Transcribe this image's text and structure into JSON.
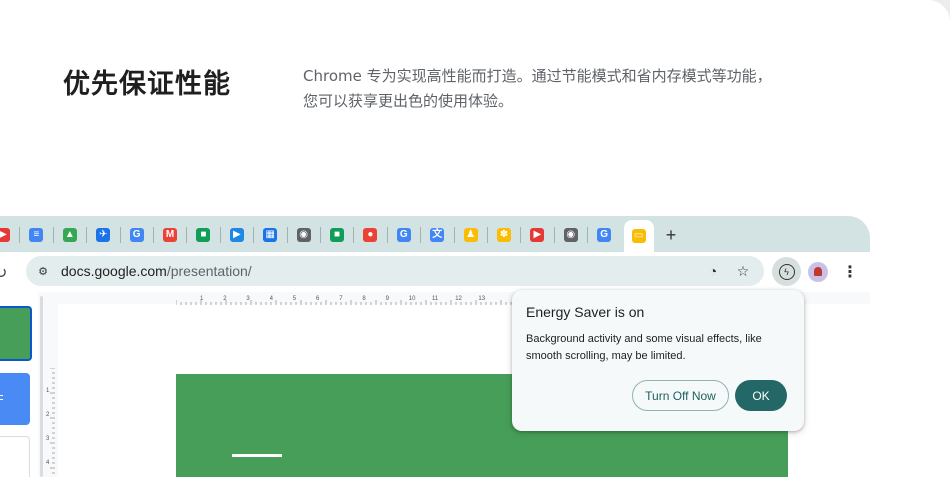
{
  "hero": {
    "title": "优先保证性能",
    "description": "Chrome 专为实现高性能而打造。通过节能模式和省内存模式等功能，您可以获享更出色的使用体验。"
  },
  "tabs": [
    {
      "icon": "youtube-icon",
      "color": "#e53935",
      "glyph": "▶"
    },
    {
      "icon": "google-docs-icon",
      "color": "#4285f4",
      "glyph": "≡"
    },
    {
      "icon": "google-drive-icon",
      "color": "#34a853",
      "glyph": "▲"
    },
    {
      "icon": "flights-icon",
      "color": "#1a73e8",
      "glyph": "✈"
    },
    {
      "icon": "google-icon",
      "color": "#4285f4",
      "glyph": "G"
    },
    {
      "icon": "gmail-icon",
      "color": "#ea4335",
      "glyph": "M"
    },
    {
      "icon": "google-meet-icon",
      "color": "#0f9d58",
      "glyph": "■"
    },
    {
      "icon": "google-play-icon",
      "color": "#1e88e5",
      "glyph": "▶"
    },
    {
      "icon": "google-calendar-icon",
      "color": "#1a73e8",
      "glyph": "▦"
    },
    {
      "icon": "chrome-icon",
      "color": "#5f6368",
      "glyph": "◉"
    },
    {
      "icon": "google-chat-icon",
      "color": "#0f9d58",
      "glyph": "■"
    },
    {
      "icon": "google-maps-icon",
      "color": "#ea4335",
      "glyph": "●"
    },
    {
      "icon": "google-icon",
      "color": "#4285f4",
      "glyph": "G"
    },
    {
      "icon": "google-translate-icon",
      "color": "#4285f4",
      "glyph": "文"
    },
    {
      "icon": "chrome-dino-icon",
      "color": "#fbbc04",
      "glyph": "♟"
    },
    {
      "icon": "google-photos-icon",
      "color": "#fbbc04",
      "glyph": "✽"
    },
    {
      "icon": "youtube-music-icon",
      "color": "#e53935",
      "glyph": "▶"
    },
    {
      "icon": "chrome-icon",
      "color": "#5f6368",
      "glyph": "◉"
    },
    {
      "icon": "google-icon",
      "color": "#4285f4",
      "glyph": "G"
    },
    {
      "icon": "google-slides-icon",
      "color": "#fbbc04",
      "glyph": "▭",
      "active": true
    }
  ],
  "toolbar": {
    "url_host": "docs.google.com",
    "url_path": "/presentation/"
  },
  "popover": {
    "title": "Energy Saver is on",
    "body": "Background activity and some visual effects, like smooth scrolling, may be limited.",
    "turn_off_label": "Turn Off Now",
    "ok_label": "OK"
  },
  "ruler": {
    "top_marks": [
      "1",
      "2",
      "3",
      "4",
      "5",
      "6",
      "7",
      "8",
      "9",
      "10",
      "11",
      "12",
      "13"
    ],
    "left_marks": [
      "1",
      "2",
      "3",
      "4"
    ]
  }
}
